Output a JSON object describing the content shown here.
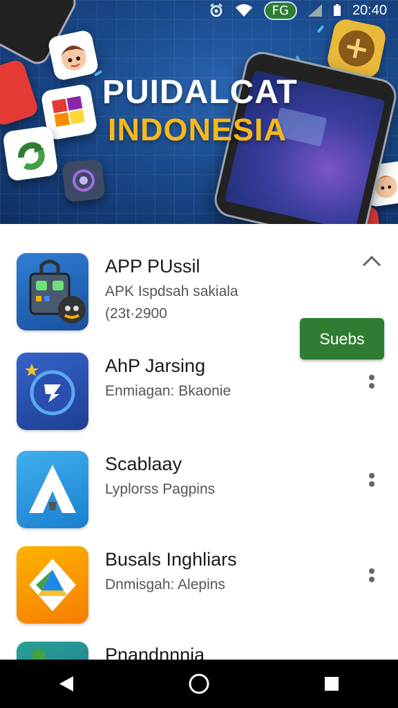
{
  "status_bar": {
    "badge": "FG",
    "time": "20:40"
  },
  "banner": {
    "title": "PUIDALCAT",
    "subtitle": "INDONESIA"
  },
  "apps": [
    {
      "name": "APP PUssil",
      "subtitle": "APK Ispdsah sakiala",
      "meta": "(23t·2900",
      "action": "Suebs",
      "expanded": true
    },
    {
      "name": "AhP Jarsing",
      "subtitle": "Enmiagan: Bkaonie"
    },
    {
      "name": "Scablaay",
      "subtitle": "Lyplorss Pagpins"
    },
    {
      "name": "Busals Inghliars",
      "subtitle": "Dnmisgah: Alepins"
    },
    {
      "name": "Pnandnnnia",
      "subtitle": ""
    }
  ],
  "nav": {
    "icons": [
      "back-icon",
      "home-icon",
      "recents-icon"
    ]
  },
  "colors": {
    "banner_bg": "#1a4a8c",
    "title_white": "#ffffff",
    "subtitle_gold": "#f6b81a",
    "install_green": "#2e7d32"
  }
}
